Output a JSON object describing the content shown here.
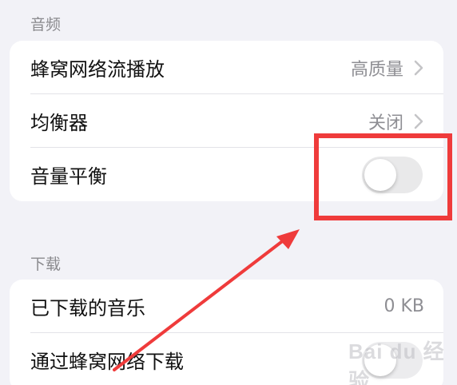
{
  "audio_section": {
    "header": "音频",
    "rows": [
      {
        "label": "蜂窝网络流播放",
        "value": "高质量"
      },
      {
        "label": "均衡器",
        "value": "关闭"
      },
      {
        "label": "音量平衡",
        "toggle_on": false
      }
    ]
  },
  "download_section": {
    "header": "下载",
    "rows": [
      {
        "label": "已下载的音乐",
        "value": "0 KB"
      },
      {
        "label": "通过蜂窝网络下载"
      }
    ]
  },
  "annotation": {
    "color": "#ef3b3b"
  },
  "watermark": "Bai du 经验",
  "colors": {
    "background": "#f2f2f7",
    "card": "#ffffff",
    "secondary_text": "#8e8e93",
    "toggle_off": "#e9e9ea"
  }
}
